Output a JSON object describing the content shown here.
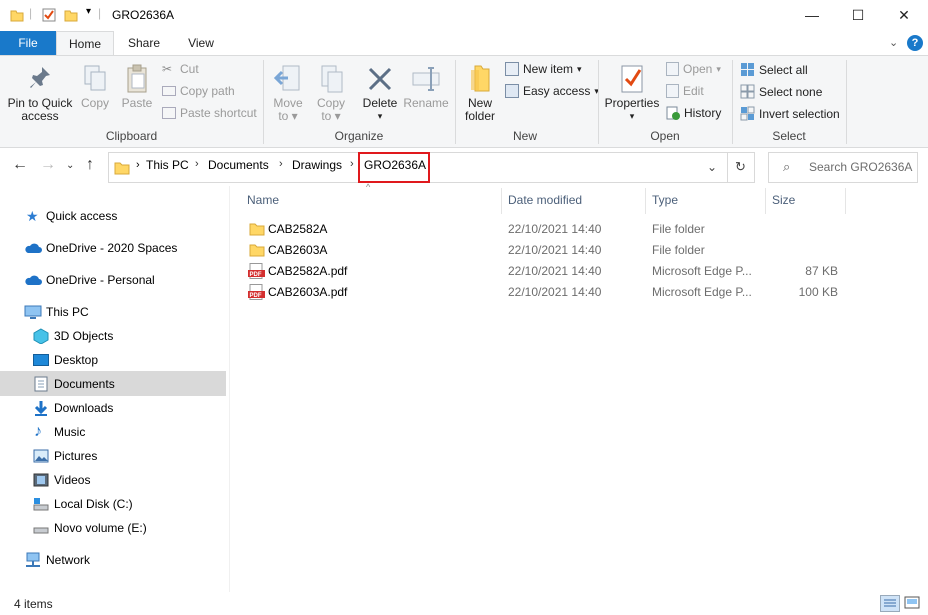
{
  "window": {
    "title": "GRO2636A",
    "controls": {
      "minimize": "—",
      "maximize": "☐",
      "close": "✕"
    }
  },
  "ribbon_tabs": [
    {
      "label": "File"
    },
    {
      "label": "Home"
    },
    {
      "label": "Share"
    },
    {
      "label": "View"
    }
  ],
  "ribbon": {
    "clipboard": {
      "group_label": "Clipboard",
      "pin_to_quick_access": [
        "Pin to Quick",
        "access"
      ],
      "copy": "Copy",
      "paste": "Paste",
      "cut": "Cut",
      "copy_path": "Copy path",
      "paste_shortcut": "Paste shortcut"
    },
    "organize": {
      "group_label": "Organize",
      "move_to": [
        "Move",
        "to"
      ],
      "copy_to": [
        "Copy",
        "to"
      ],
      "delete": "Delete",
      "rename": "Rename"
    },
    "new": {
      "group_label": "New",
      "new_folder": [
        "New",
        "folder"
      ],
      "new_item": "New item",
      "easy_access": "Easy access"
    },
    "open": {
      "group_label": "Open",
      "properties": "Properties",
      "open": "Open",
      "edit": "Edit",
      "history": "History"
    },
    "select": {
      "group_label": "Select",
      "select_all": "Select all",
      "select_none": "Select none",
      "invert_selection": "Invert selection"
    }
  },
  "address_bar": {
    "breadcrumbs": [
      "This PC",
      "Documents",
      "Drawings",
      "GRO2636A"
    ],
    "search_placeholder": "Search GRO2636A"
  },
  "nav_pane": {
    "items": [
      {
        "label": "Quick access",
        "icon": "star-icon"
      },
      {
        "label": "OneDrive - 2020 Spaces",
        "icon": "cloud-icon"
      },
      {
        "label": "OneDrive - Personal",
        "icon": "cloud-icon"
      },
      {
        "label": "This PC",
        "icon": "computer-icon"
      },
      {
        "label": "3D Objects",
        "icon": "cube-icon"
      },
      {
        "label": "Desktop",
        "icon": "desktop-icon"
      },
      {
        "label": "Documents",
        "icon": "document-icon",
        "selected": true
      },
      {
        "label": "Downloads",
        "icon": "download-icon"
      },
      {
        "label": "Music",
        "icon": "music-icon"
      },
      {
        "label": "Pictures",
        "icon": "picture-icon"
      },
      {
        "label": "Videos",
        "icon": "video-icon"
      },
      {
        "label": "Local Disk (C:)",
        "icon": "drive-icon"
      },
      {
        "label": "Novo volume (E:)",
        "icon": "drive-icon"
      },
      {
        "label": "Network",
        "icon": "network-icon"
      }
    ]
  },
  "file_list": {
    "columns": [
      "Name",
      "Date modified",
      "Type",
      "Size"
    ],
    "rows": [
      {
        "name": "CAB2582A",
        "date": "22/10/2021 14:40",
        "type": "File folder",
        "size": "",
        "icon": "folder-icon"
      },
      {
        "name": "CAB2603A",
        "date": "22/10/2021 14:40",
        "type": "File folder",
        "size": "",
        "icon": "folder-icon"
      },
      {
        "name": "CAB2582A.pdf",
        "date": "22/10/2021 14:40",
        "type": "Microsoft Edge P...",
        "size": "87 KB",
        "icon": "pdf-icon"
      },
      {
        "name": "CAB2603A.pdf",
        "date": "22/10/2021 14:40",
        "type": "Microsoft Edge P...",
        "size": "100 KB",
        "icon": "pdf-icon"
      }
    ]
  },
  "status_bar": {
    "item_count": "4 items"
  },
  "colors": {
    "file_tab": "#1979ca",
    "highlight_border": "#e0191d",
    "selected_nav": "#d9d9d9",
    "folder": "#ffd766"
  }
}
